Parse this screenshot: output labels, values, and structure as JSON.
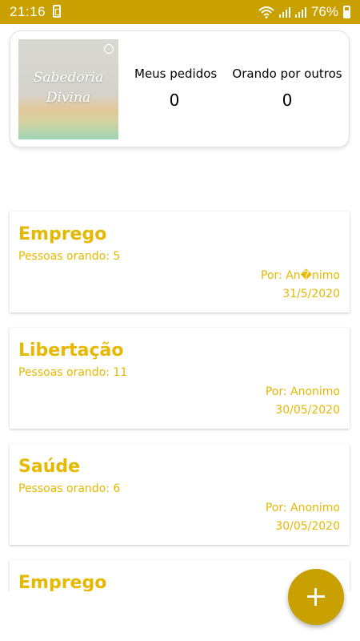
{
  "status_bar": {
    "time": "21:16",
    "battery": "76%",
    "icons": [
      "notification-icon",
      "wifi-icon",
      "signal-icon",
      "signal-icon",
      "battery-icon"
    ]
  },
  "header": {
    "cover_title_line1": "Sabedoria",
    "cover_title_line2": "Divina",
    "meus_pedidos": {
      "label": "Meus pedidos",
      "value": "0"
    },
    "orando_por_outros": {
      "label": "Orando por outros",
      "value": "0"
    }
  },
  "prayers": [
    {
      "title": "Emprego",
      "people": "Pessoas orando: 5",
      "author": "Por: An�nimo",
      "date": "31/5/2020"
    },
    {
      "title": "Libertação",
      "people": "Pessoas orando: 11",
      "author": "Por: Anonimo",
      "date": "30/05/2020"
    },
    {
      "title": "Saúde",
      "people": "Pessoas orando: 6",
      "author": "Por: Anonimo",
      "date": "30/05/2020"
    },
    {
      "title": "Emprego",
      "people": "",
      "author": "",
      "date": ""
    }
  ],
  "colors": {
    "accent": "#c8a000",
    "title_text": "#e6b800"
  },
  "fab": {
    "icon": "plus-icon"
  }
}
